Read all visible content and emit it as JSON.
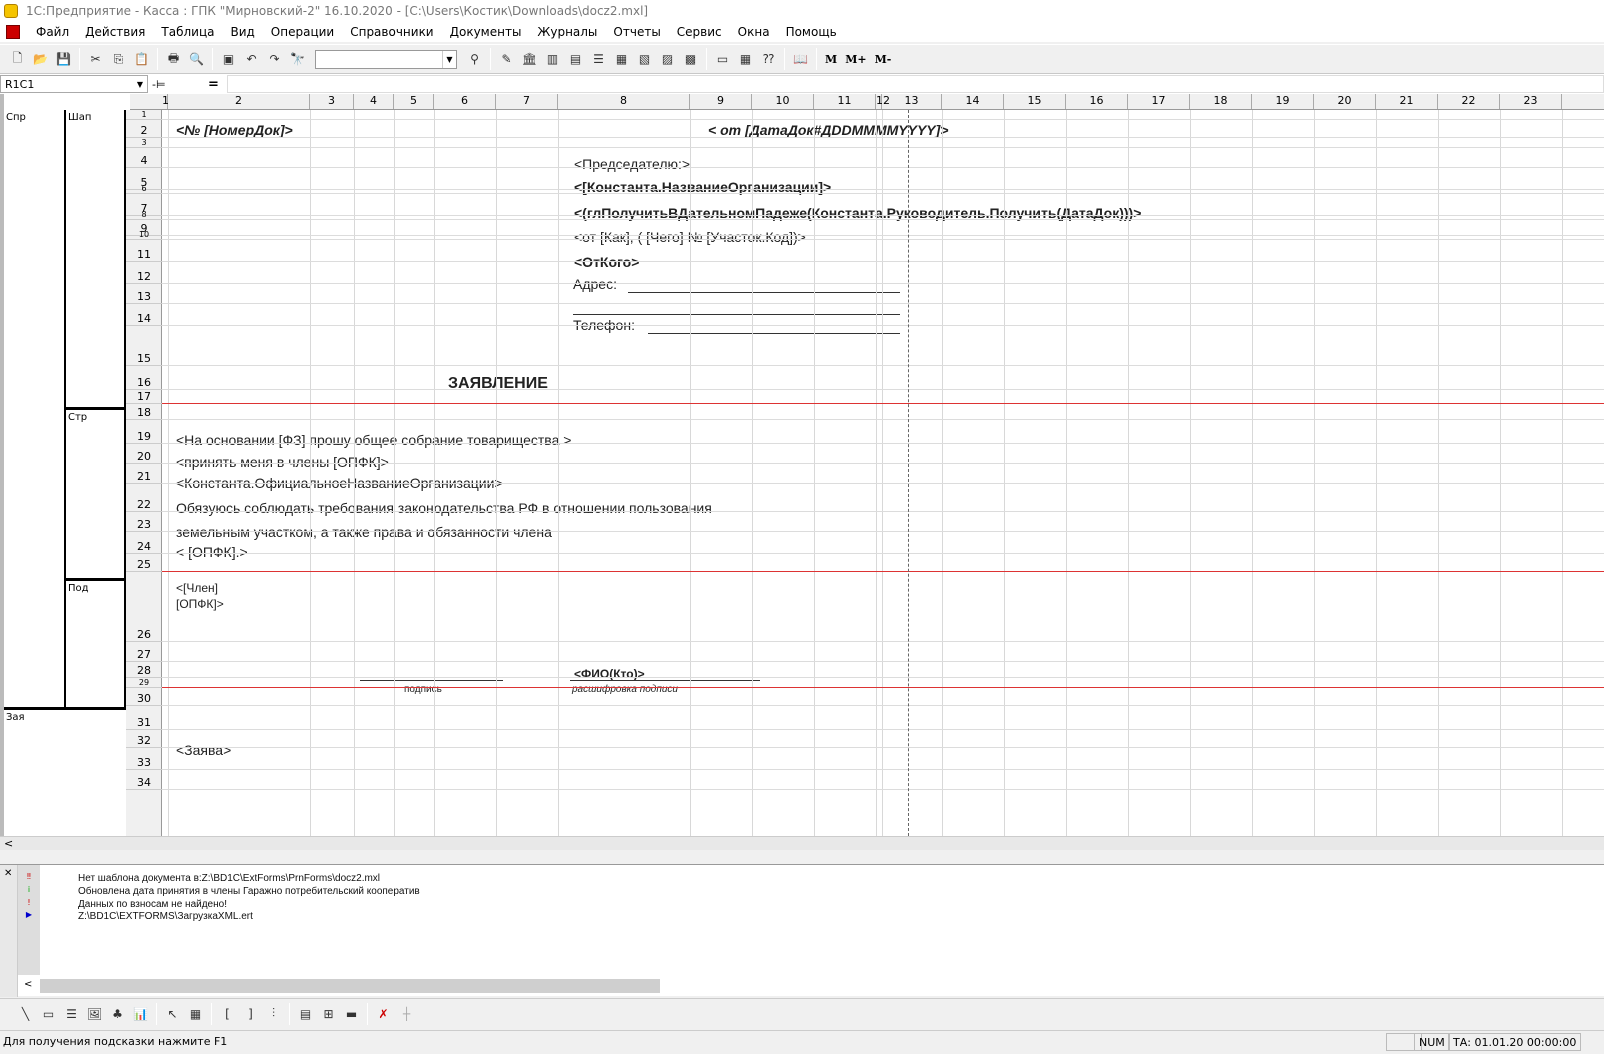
{
  "window": {
    "title": "1С:Предприятие - Касса :  ГПК \"Мирновский-2\"  16.10.2020 - [C:\\Users\\Костик\\Downloads\\docz2.mxl]"
  },
  "menu": [
    "Файл",
    "Действия",
    "Таблица",
    "Вид",
    "Операции",
    "Справочники",
    "Документы",
    "Журналы",
    "Отчеты",
    "Сервис",
    "Окна",
    "Помощь"
  ],
  "toolbar": {
    "mem": [
      "M",
      "M+",
      "M-"
    ]
  },
  "formula": {
    "cell_ref": "R1C1",
    "equals": "="
  },
  "sheet": {
    "columns": [
      "1",
      "2",
      "3",
      "4",
      "5",
      "6",
      "7",
      "8",
      "9",
      "10",
      "11",
      "12",
      "13",
      "14",
      "15",
      "16",
      "17",
      "18",
      "19",
      "20",
      "21",
      "22",
      "23"
    ],
    "rows": [
      "1",
      "2",
      "3",
      "4",
      "5",
      "6",
      "7",
      "8",
      "9",
      "10",
      "11",
      "12",
      "13",
      "14",
      "15",
      "16",
      "17",
      "18",
      "19",
      "20",
      "21",
      "22",
      "23",
      "24",
      "25",
      "26",
      "27",
      "28",
      "29",
      "30",
      "31",
      "32",
      "33",
      "34"
    ],
    "sections": {
      "s1": "Спр",
      "s2": "Шап",
      "s3": "Стр",
      "s4": "Под",
      "s5": "Зая"
    },
    "cells": {
      "c1": "<№ [НомерДок]>",
      "c2": "< от  [ДатаДок#ДDDMMMMYYYY]>",
      "c3": "<Председателю:>",
      "c4": "<[Константа.НазваниеОрганизации]>",
      "c5": "<(глПолучитьВДательномПадеже(Константа.Руководитель.Получить(ДатаДок)))>",
      "c6": "<от [Как], ( [Чего] № [Участок.Код])>",
      "c7": "<ОтКого>",
      "c8": "Адрес:",
      "c9": "Телефон:",
      "c10": "ЗАЯВЛЕНИЕ",
      "c11": "<На основании [ФЗ] прошу общее собрание товарищества >",
      "c12": "<принять меня в члены [ОПФК]>",
      "c13": "<Константа.ОфициальноеНазваниеОрганизации>",
      "c14": "Обязуюсь соблюдать требования законодательства РФ в отношении пользования",
      "c15": "земельным участком, а также права и обязанности члена",
      "c16": "< [ОПФК].>",
      "c17": "<[Член]",
      "c18": "[ОПФК]>",
      "c19": "<ФИО(Кто)>",
      "c20": "подпись",
      "c21": "расшифровка подписи",
      "c22": "<Заява>"
    }
  },
  "messages": [
    "Нет шаблона документа в:Z:\\BD1C\\ExtForms\\PrnForms\\docz2.mxl",
    "Обновлена дата принятия в члены Гаражно потребительский кооператив",
    "Данных по взносам не найдено!",
    "Z:\\BD1C\\EXTFORMS\\ЗагрузкаXML.ert"
  ],
  "status": {
    "hint": "Для получения подсказки нажмите F1",
    "num": "NUM",
    "ta": "ТА: 01.01.20  00:00:00"
  }
}
